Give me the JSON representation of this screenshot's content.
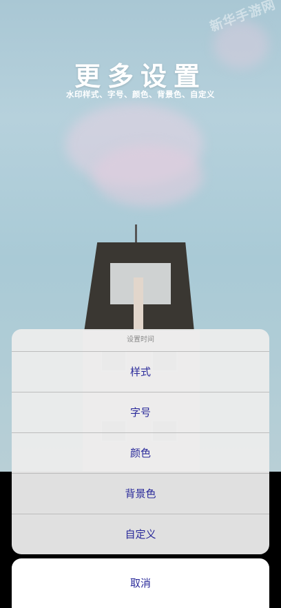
{
  "header": {
    "title": "更多设置",
    "subtitle": "水印样式、字号、颜色、背景色、自定义"
  },
  "action_sheet": {
    "header": "设置时间",
    "items": [
      {
        "label": "样式"
      },
      {
        "label": "字号"
      },
      {
        "label": "颜色"
      },
      {
        "label": "背景色"
      },
      {
        "label": "自定义"
      }
    ],
    "cancel_label": "取消"
  },
  "watermark": {
    "text": "新华手游网"
  },
  "colors": {
    "accent_text": "#2a2a9a",
    "sheet_bg": "#ececec",
    "sky": "#a9c7d4"
  }
}
